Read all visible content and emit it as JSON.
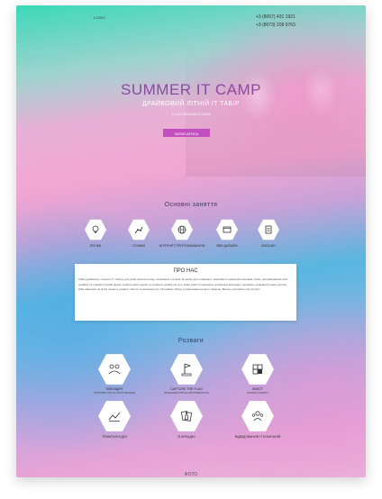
{
  "header": {
    "logo": "LOGO",
    "phone1": "+3 (8067) 431 1921",
    "phone2": "+3 (8073) 209 9763"
  },
  "hero": {
    "title": "SUMMER IT CAMP",
    "subtitle": "ДРАЙВОВИЙ ЛІТНІЙ IT ТАБІР",
    "dates": "1.1.07.2018-06.07.2018",
    "button": "ЗАПИСАТИСЬ"
  },
  "main_activities": {
    "title": "Основні заняття",
    "items": [
      {
        "label": "ЛОГІКА",
        "icon": "bulb-icon"
      },
      {
        "label": "СТАНКИ",
        "icon": "robot-arm-icon"
      },
      {
        "label": "ІНТЕРНЕТ ПРОГРАМУВАННЯ",
        "icon": "globe-icon"
      },
      {
        "label": "ВЕБ-ДИЗАЙН",
        "icon": "web-design-icon"
      },
      {
        "label": "ENGLISH",
        "icon": "english-icon"
      }
    ]
  },
  "about": {
    "title": "ПРО НАС",
    "text": "Табір драйвового літнього IT табору для дітей шкільного віку, починаючи з 9 років. В ньому діти отримають можливість навчатися основам логіки, програмування, веб-дизайну та станків в ігровій формі, знайти нових друзів та провести незабутнє літо. Наші заняття проводять досвідчені викладачі, які вміють зацікавити кожну дитину. Крім навчання на дітей чекають розваги, квести та командні ігри. Програма табору розрахована на один тиждень. Більше розповімо при зустрічі."
  },
  "entertainment": {
    "title": "Розваги",
    "items": [
      {
        "label": "ТІМБІЛДІНГ",
        "sub": "(ГРУПОВІ ІГРИ НА ЗГУРТУВАННЯ)",
        "icon": "teamwork-icon"
      },
      {
        "label": "CAPTURE THE FLAG",
        "sub": "(КОМАНДНІ ІГРИ НА ВИТРИВАЛІСТЬ)",
        "icon": "flag-icon"
      },
      {
        "label": "КВЕСТ",
        "sub": "(ПОШУК СКАРБУ)",
        "icon": "puzzle-icon"
      },
      {
        "label": "ТЕМАТИЧНІ ДНІ",
        "sub": "",
        "icon": "chart-icon"
      },
      {
        "label": "Й АРКАДНІ",
        "sub": "",
        "icon": "cards-icon"
      },
      {
        "label": "ВІДВІДУВАННЯ IT КОМПАНІЙ",
        "sub": "",
        "icon": "people-icon"
      }
    ]
  },
  "footer": {
    "partial_title": "ФОТО"
  }
}
